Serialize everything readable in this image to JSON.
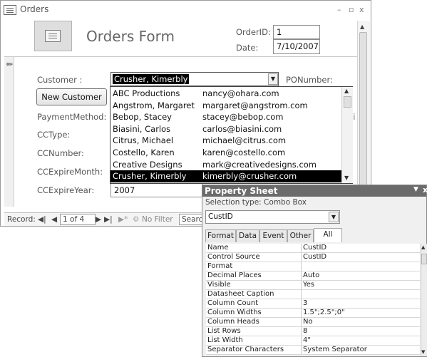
{
  "window": {
    "title": "Orders",
    "icon": "form-icon",
    "buttons": [
      "–",
      "▫",
      "x"
    ]
  },
  "form": {
    "title": "Orders Form",
    "order_id_label": "OrderID:",
    "order_id_value": "1",
    "date_label": "Date:",
    "date_value": "7/10/2007",
    "customer_label": "Customer :",
    "customer_value": "Crusher, Kimerbly",
    "ponumber_label": "PONumber:",
    "new_customer_button": "New Customer",
    "payment_label": "PaymentMethod:",
    "cctype_label": "CCType:",
    "ccnumber_label": "CCNumber:",
    "ccexpire_month_label": "CCExpireMonth:",
    "ccexpire_year_label": "CCExpireYear:",
    "ccexpire_year_value": "2007",
    "clipped_right_text": "li"
  },
  "dropdown": {
    "rows": [
      {
        "name": "ABC Productions",
        "email": "nancy@ohara.com"
      },
      {
        "name": "Angstrom, Margaret",
        "email": "margaret@angstrom.com"
      },
      {
        "name": "Bebop, Stacey",
        "email": "stacey@bebop.com"
      },
      {
        "name": "Biasini, Carlos",
        "email": "carlos@biasini.com"
      },
      {
        "name": "Citrus, Michael",
        "email": "michael@citrus.com"
      },
      {
        "name": "Costello, Karen",
        "email": "karen@costello.com"
      },
      {
        "name": "Creative Designs",
        "email": "mark@creativedesigns.com"
      },
      {
        "name": "Crusher, Kimerbly",
        "email": "kimerbly@crusher.com"
      }
    ],
    "selected_index": 7
  },
  "record_nav": {
    "label": "Record:",
    "position": "1 of 4",
    "filter": "No Filter",
    "search": "Search"
  },
  "property_sheet": {
    "title": "Property Sheet",
    "selection_type": "Selection type:  Combo Box",
    "object": "CustID",
    "tabs": [
      "Format",
      "Data",
      "Event",
      "Other",
      "All"
    ],
    "active_tab": "All",
    "properties": [
      {
        "name": "Name",
        "value": "CustID"
      },
      {
        "name": "Control Source",
        "value": "CustID"
      },
      {
        "name": "Format",
        "value": ""
      },
      {
        "name": "Decimal Places",
        "value": "Auto"
      },
      {
        "name": "Visible",
        "value": "Yes"
      },
      {
        "name": "Datasheet Caption",
        "value": ""
      },
      {
        "name": "Column Count",
        "value": "3"
      },
      {
        "name": "Column Widths",
        "value": "1.5\";2.5\";0\""
      },
      {
        "name": "Column Heads",
        "value": "No"
      },
      {
        "name": "List Rows",
        "value": "8"
      },
      {
        "name": "List Width",
        "value": "4\""
      },
      {
        "name": "Separator Characters",
        "value": "System Separator"
      }
    ]
  }
}
